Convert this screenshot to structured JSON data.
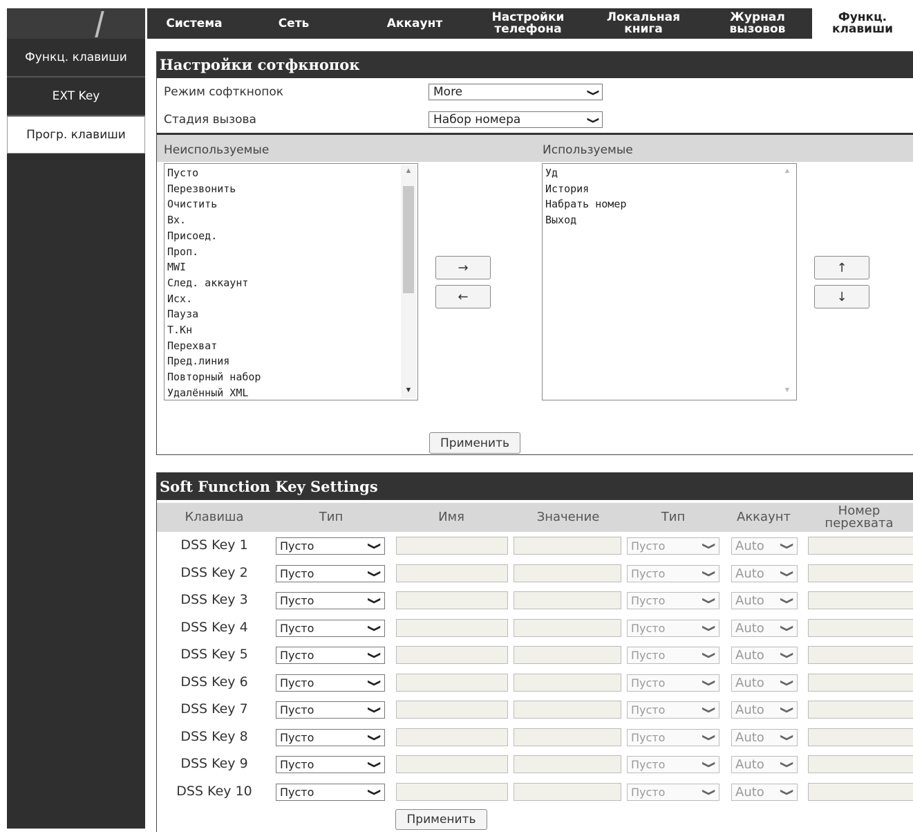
{
  "nav": {
    "tabs": [
      {
        "label": "Система"
      },
      {
        "label": "Сеть"
      },
      {
        "label": "Аккаунт"
      },
      {
        "label": "Настройки телефона"
      },
      {
        "label": "Локальная книга"
      },
      {
        "label": "Журнал вызовов"
      },
      {
        "label": "Функц. клавиши"
      }
    ]
  },
  "sidebar": {
    "items": [
      {
        "label": "Функц. клавиши"
      },
      {
        "label": "EXT Key"
      },
      {
        "label": "Прогр. клавиши"
      }
    ]
  },
  "softkeys": {
    "title": "Настройки сотфкнопок",
    "mode_label": "Режим софткнопок",
    "mode_value": "More",
    "stage_label": "Стадия вызова",
    "stage_value": "Набор номера",
    "unused_label": "Неиспользуемые",
    "used_label": "Используемые",
    "unused_items": [
      "Пусто",
      "Перезвонить",
      "Очистить",
      "Вх.",
      "Присоед.",
      "Проп.",
      "MWI",
      "След. аккаунт",
      "Исх.",
      "Пауза",
      "Т.Кн",
      "Перехват",
      "Пред.линия",
      "Повторный набор",
      "Удалённый XML"
    ],
    "used_items": [
      "Уд",
      "История",
      "Набрать номер",
      "Выход"
    ],
    "move_right": "→",
    "move_left": "←",
    "move_up": "↑",
    "move_down": "↓",
    "apply": "Применить"
  },
  "sfk": {
    "title": "Soft Function Key Settings",
    "headers": [
      "Клавиша",
      "Тип",
      "Имя",
      "Значение",
      "Тип",
      "Аккаунт",
      "Номер перехвата"
    ],
    "rows": [
      {
        "key": "DSS Key 1",
        "type": "Пусто",
        "type2": "Пусто",
        "account": "Auto"
      },
      {
        "key": "DSS Key 2",
        "type": "Пусто",
        "type2": "Пусто",
        "account": "Auto"
      },
      {
        "key": "DSS Key 3",
        "type": "Пусто",
        "type2": "Пусто",
        "account": "Auto"
      },
      {
        "key": "DSS Key 4",
        "type": "Пусто",
        "type2": "Пусто",
        "account": "Auto"
      },
      {
        "key": "DSS Key 5",
        "type": "Пусто",
        "type2": "Пусто",
        "account": "Auto"
      },
      {
        "key": "DSS Key 6",
        "type": "Пусто",
        "type2": "Пусто",
        "account": "Auto"
      },
      {
        "key": "DSS Key 7",
        "type": "Пусто",
        "type2": "Пусто",
        "account": "Auto"
      },
      {
        "key": "DSS Key 8",
        "type": "Пусто",
        "type2": "Пусто",
        "account": "Auto"
      },
      {
        "key": "DSS Key 9",
        "type": "Пусто",
        "type2": "Пусто",
        "account": "Auto"
      },
      {
        "key": "DSS Key 10",
        "type": "Пусто",
        "type2": "Пусто",
        "account": "Auto"
      }
    ],
    "apply": "Применить"
  }
}
